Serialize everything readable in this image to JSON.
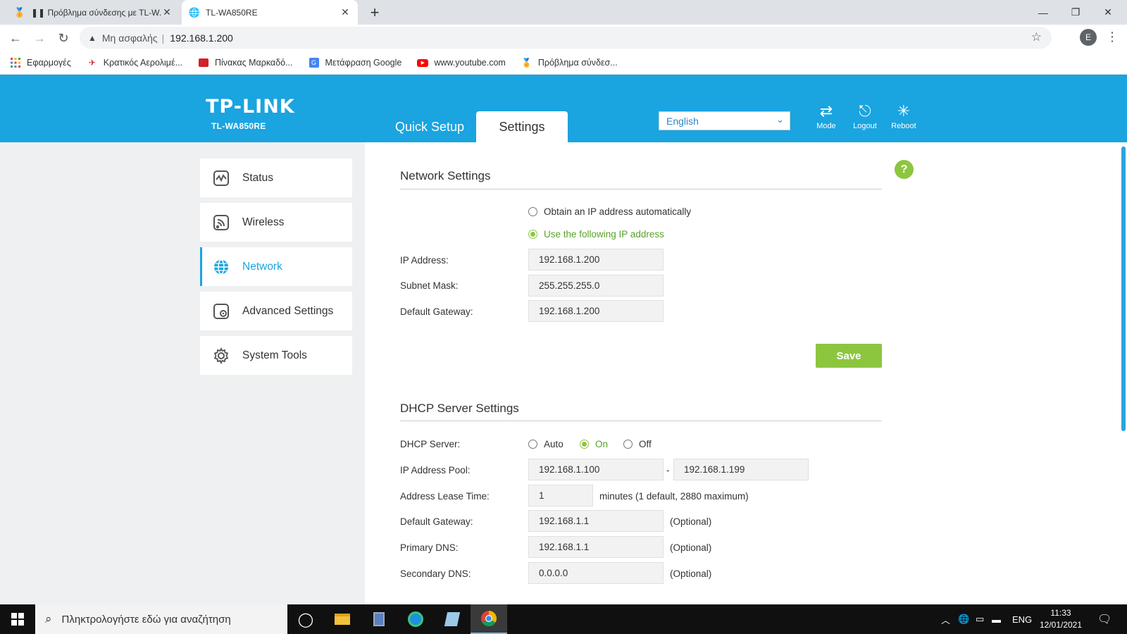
{
  "browser": {
    "tabs": [
      {
        "title": "❚❚ Πρόβλημα σύνδεσης με TL-W...",
        "active": false,
        "favicon": "award-icon"
      },
      {
        "title": "TL-WA850RE",
        "active": true,
        "favicon": "globe-icon"
      }
    ],
    "address": {
      "security_label": "Μη ασφαλής",
      "url": "192.168.1.200"
    },
    "profile_initial": "E",
    "bookmarks": [
      {
        "label": "Εφαρμογές",
        "icon": "apps-grid-icon"
      },
      {
        "label": "Κρατικός Αερολιμέ...",
        "icon": "airplane-icon"
      },
      {
        "label": "Πίνακας Μαρκαδό...",
        "icon": "bookmark-folder-icon"
      },
      {
        "label": "Μετάφραση Google",
        "icon": "translate-icon"
      },
      {
        "label": "www.youtube.com",
        "icon": "youtube-icon"
      },
      {
        "label": "Πρόβλημα σύνδεσ...",
        "icon": "award-icon"
      }
    ]
  },
  "router": {
    "brand": "TP-LINK",
    "model": "TL-WA850RE",
    "tabs": {
      "quick_setup": "Quick Setup",
      "settings": "Settings"
    },
    "language": "English",
    "header_actions": {
      "mode": "Mode",
      "logout": "Logout",
      "reboot": "Reboot"
    },
    "nav": [
      {
        "label": "Status",
        "icon": "status-icon",
        "active": false
      },
      {
        "label": "Wireless",
        "icon": "wireless-icon",
        "active": false
      },
      {
        "label": "Network",
        "icon": "globe-icon",
        "active": true
      },
      {
        "label": "Advanced Settings",
        "icon": "advanced-settings-icon",
        "active": false
      },
      {
        "label": "System Tools",
        "icon": "gear-icon",
        "active": false
      }
    ],
    "network": {
      "title": "Network Settings",
      "opt_auto": "Obtain an IP address automatically",
      "opt_static": "Use the following IP address",
      "selected": "static",
      "ip_label": "IP Address:",
      "ip_value": "192.168.1.200",
      "mask_label": "Subnet Mask:",
      "mask_value": "255.255.255.0",
      "gw_label": "Default Gateway:",
      "gw_value": "192.168.1.200",
      "save": "Save"
    },
    "dhcp": {
      "title": "DHCP Server Settings",
      "server_label": "DHCP Server:",
      "options": {
        "auto": "Auto",
        "on": "On",
        "off": "Off"
      },
      "selected": "on",
      "pool_label": "IP Address Pool:",
      "pool_start": "192.168.1.100",
      "pool_sep": "-",
      "pool_end": "192.168.1.199",
      "lease_label": "Address Lease Time:",
      "lease_value": "1",
      "lease_note": "minutes (1 default, 2880 maximum)",
      "gw_label": "Default Gateway:",
      "gw_value": "192.168.1.1",
      "pdns_label": "Primary DNS:",
      "pdns_value": "192.168.1.1",
      "sdns_label": "Secondary DNS:",
      "sdns_value": "0.0.0.0",
      "optional": "(Optional)"
    },
    "help_symbol": "?"
  },
  "taskbar": {
    "search_placeholder": "Πληκτρολογήστε εδώ για αναζήτηση",
    "language": "ENG",
    "time": "11:33",
    "date": "12/01/2021"
  },
  "colors": {
    "header_blue": "#1aa4e0",
    "accent_green": "#8cc63f"
  }
}
